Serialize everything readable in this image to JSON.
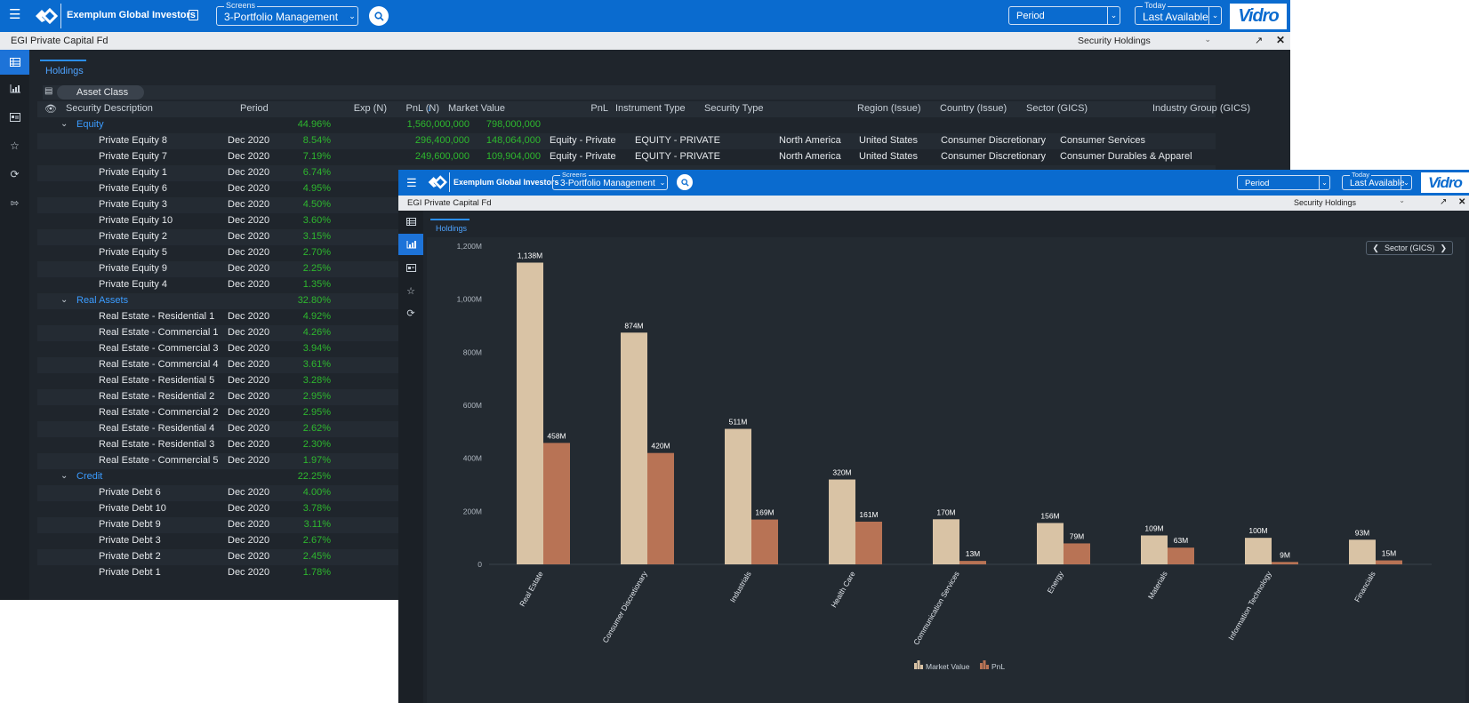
{
  "window1": {
    "app_name": "Exemplum Global Investors",
    "screens": {
      "caption": "Screens",
      "value": "3-Portfolio Management"
    },
    "period": {
      "value": "Period"
    },
    "today": {
      "caption": "Today",
      "value": "Last Available"
    },
    "brand": "Vidro",
    "fund": "EGI Private Capital Fd",
    "view": "Security Holdings",
    "tab": "Holdings",
    "group_chip": "Asset Class",
    "columns": {
      "security": "Security Description",
      "period": "Period",
      "exp": "Exp (N)",
      "pnl_n": "PnL (N)",
      "mv": "Market Value",
      "pnl": "PnL",
      "instrument": "Instrument Type",
      "sectype": "Security Type",
      "region": "Region (Issue)",
      "country": "Country (Issue)",
      "sector": "Sector (GICS)",
      "industry": "Industry Group (GICS)"
    },
    "groups": {
      "equity": {
        "name": "Equity",
        "exp": "44.96%",
        "mv": "1,560,000,000",
        "pnl": "798,000,000"
      },
      "real_assets": {
        "name": "Real Assets",
        "exp": "32.80%"
      },
      "credit": {
        "name": "Credit",
        "exp": "22.25%"
      }
    },
    "equity_rows": [
      {
        "name": "Private Equity 8",
        "period": "Dec 2020",
        "exp": "8.54%",
        "mv": "296,400,000",
        "pnl": "148,064,000",
        "instrument": "Equity - Private",
        "sectype": "EQUITY - PRIVATE",
        "region": "North America",
        "country": "United States",
        "sector": "Consumer Discretionary",
        "industry": "Consumer Services"
      },
      {
        "name": "Private Equity 7",
        "period": "Dec 2020",
        "exp": "7.19%",
        "mv": "249,600,000",
        "pnl": "109,904,000",
        "instrument": "Equity - Private",
        "sectype": "EQUITY - PRIVATE",
        "region": "North America",
        "country": "United States",
        "sector": "Consumer Discretionary",
        "industry": "Consumer Durables & Apparel"
      },
      {
        "name": "Private Equity 1",
        "period": "Dec 2020",
        "exp": "6.74%"
      },
      {
        "name": "Private Equity 6",
        "period": "Dec 2020",
        "exp": "4.95%"
      },
      {
        "name": "Private Equity 3",
        "period": "Dec 2020",
        "exp": "4.50%"
      },
      {
        "name": "Private Equity 10",
        "period": "Dec 2020",
        "exp": "3.60%"
      },
      {
        "name": "Private Equity 2",
        "period": "Dec 2020",
        "exp": "3.15%"
      },
      {
        "name": "Private Equity 5",
        "period": "Dec 2020",
        "exp": "2.70%"
      },
      {
        "name": "Private Equity 9",
        "period": "Dec 2020",
        "exp": "2.25%"
      },
      {
        "name": "Private Equity 4",
        "period": "Dec 2020",
        "exp": "1.35%"
      }
    ],
    "real_rows": [
      {
        "name": "Real Estate - Residential 1",
        "period": "Dec 2020",
        "exp": "4.92%"
      },
      {
        "name": "Real Estate - Commercial 1",
        "period": "Dec 2020",
        "exp": "4.26%"
      },
      {
        "name": "Real Estate - Commercial 3",
        "period": "Dec 2020",
        "exp": "3.94%"
      },
      {
        "name": "Real Estate - Commercial 4",
        "period": "Dec 2020",
        "exp": "3.61%"
      },
      {
        "name": "Real Estate - Residential 5",
        "period": "Dec 2020",
        "exp": "3.28%"
      },
      {
        "name": "Real Estate - Residential 2",
        "period": "Dec 2020",
        "exp": "2.95%"
      },
      {
        "name": "Real Estate - Commercial 2",
        "period": "Dec 2020",
        "exp": "2.95%"
      },
      {
        "name": "Real Estate - Residential 4",
        "period": "Dec 2020",
        "exp": "2.62%"
      },
      {
        "name": "Real Estate - Residential 3",
        "period": "Dec 2020",
        "exp": "2.30%"
      },
      {
        "name": "Real Estate - Commercial 5",
        "period": "Dec 2020",
        "exp": "1.97%"
      }
    ],
    "credit_rows": [
      {
        "name": "Private Debt 6",
        "period": "Dec 2020",
        "exp": "4.00%"
      },
      {
        "name": "Private Debt 10",
        "period": "Dec 2020",
        "exp": "3.78%"
      },
      {
        "name": "Private Debt 9",
        "period": "Dec 2020",
        "exp": "3.11%"
      },
      {
        "name": "Private Debt 3",
        "period": "Dec 2020",
        "exp": "2.67%"
      },
      {
        "name": "Private Debt 2",
        "period": "Dec 2020",
        "exp": "2.45%"
      },
      {
        "name": "Private Debt 1",
        "period": "Dec 2020",
        "exp": "1.78%"
      }
    ]
  },
  "window2": {
    "app_name": "Exemplum Global Investors",
    "screens": {
      "caption": "Screens",
      "value": "3-Portfolio Management"
    },
    "period": {
      "value": "Period"
    },
    "today": {
      "caption": "Today",
      "value": "Last Available"
    },
    "brand": "Vidro",
    "fund": "EGI Private Capital Fd",
    "view": "Security Holdings",
    "tab": "Holdings",
    "grouping": "Sector (GICS)"
  },
  "colors": {
    "accent": "#0a6bcf",
    "market_value": "#d9c3a5",
    "pnl": "#b87355",
    "positive": "#2eb82e",
    "group": "#3b9cff"
  },
  "chart_data": {
    "type": "bar",
    "categories": [
      "Real Estate",
      "Consumer Discretionary",
      "Industrials",
      "Health Care",
      "Communication Services",
      "Energy",
      "Materials",
      "Information Technology",
      "Financials"
    ],
    "series": [
      {
        "name": "Market Value",
        "values": [
          1138,
          874,
          511,
          320,
          170,
          156,
          109,
          100,
          93
        ],
        "labels": [
          "1,138M",
          "874M",
          "511M",
          "320M",
          "170M",
          "156M",
          "109M",
          "100M",
          "93M"
        ]
      },
      {
        "name": "PnL",
        "values": [
          458,
          420,
          169,
          161,
          13,
          79,
          63,
          9,
          15
        ],
        "labels": [
          "458M",
          "420M",
          "169M",
          "161M",
          "13M",
          "79M",
          "63M",
          "9M",
          "15M"
        ]
      }
    ],
    "ylim": [
      0,
      1200
    ],
    "yticks": [
      "0",
      "200M",
      "400M",
      "600M",
      "800M",
      "1,000M",
      "1,200M"
    ],
    "legend": "bottom-center",
    "grid": false
  }
}
